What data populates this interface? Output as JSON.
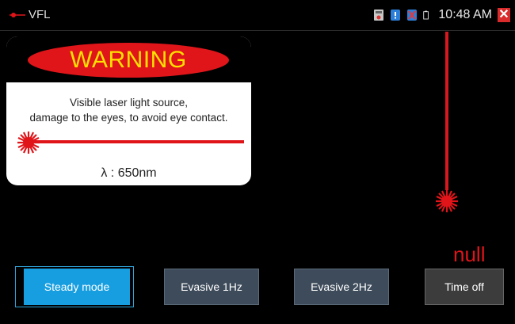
{
  "statusbar": {
    "app_title": "VFL",
    "time": "10:48 AM",
    "icons": [
      "vfl-app-icon",
      "storage-icon",
      "notification-icon",
      "usb-icon",
      "battery-icon",
      "close-icon"
    ]
  },
  "warning": {
    "title": "WARNING",
    "line1": "Visible laser light source,",
    "line2": "damage to the eyes, to avoid eye contact.",
    "wavelength": "λ : 650nm"
  },
  "laser": {
    "status": "null",
    "color": "#e0151a"
  },
  "buttons": {
    "steady": "Steady mode",
    "evasive1": "Evasive 1Hz",
    "evasive2": "Evasive 2Hz",
    "timeoff": "Time off"
  },
  "colors": {
    "accent": "#179ee0",
    "laser_red": "#e0151a",
    "warning_yellow": "#ffe000"
  }
}
